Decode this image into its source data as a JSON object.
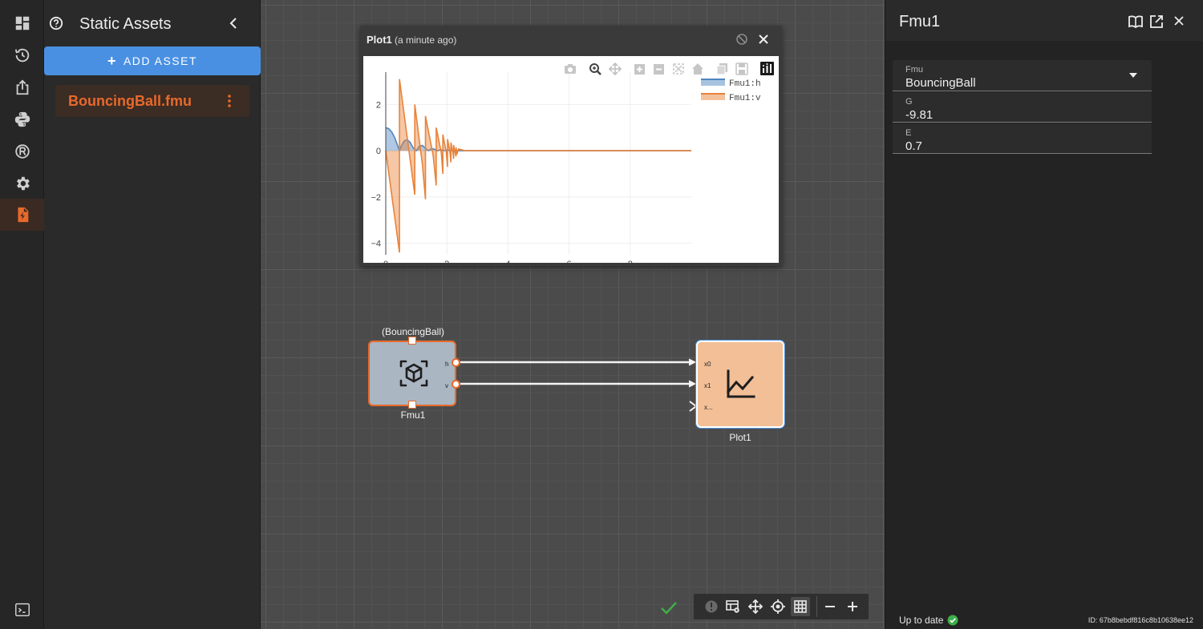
{
  "rail": {
    "items": [
      {
        "name": "dashboard",
        "icon": "dashboard-icon"
      },
      {
        "name": "history",
        "icon": "history-icon"
      },
      {
        "name": "export",
        "icon": "export-icon"
      },
      {
        "name": "python",
        "icon": "python-icon"
      },
      {
        "name": "registry",
        "icon": "registry-icon"
      },
      {
        "name": "settings",
        "icon": "gear-icon"
      },
      {
        "name": "static-assets",
        "icon": "file-bolt-icon",
        "active": true
      }
    ],
    "terminal_icon": "terminal-icon"
  },
  "assets_panel": {
    "title": "Static Assets",
    "add_button": "ADD ASSET",
    "items": [
      {
        "label": "BouncingBall.fmu"
      }
    ]
  },
  "plot_window": {
    "title": "Plot1",
    "subtitle": "(a minute ago)",
    "chart_data": {
      "type": "area",
      "title": "",
      "xlabel": "",
      "ylabel": "",
      "xlim": [
        0,
        10
      ],
      "ylim": [
        -4.5,
        3.4
      ],
      "x_ticks": [
        0,
        2,
        4,
        6,
        8
      ],
      "y_ticks": [
        -4,
        -2,
        0,
        2
      ],
      "grid": true,
      "legend_position": "top-right",
      "series": [
        {
          "name": "Fmu1:h",
          "color": "#4f86c0",
          "x": [
            0,
            0.1,
            0.2,
            0.3,
            0.45,
            0.5,
            0.6,
            0.7,
            0.8,
            0.9,
            1.0,
            1.1,
            1.2,
            1.3,
            1.4,
            1.5,
            1.6,
            1.7,
            1.8,
            1.9,
            2.0,
            2.1,
            2.2,
            2.3,
            2.4,
            2.6,
            10
          ],
          "y": [
            1.0,
            0.95,
            0.8,
            0.55,
            0.0,
            0.18,
            0.42,
            0.48,
            0.36,
            0.12,
            0.0,
            0.2,
            0.23,
            0.1,
            0.0,
            0.1,
            0.06,
            0.0,
            0.05,
            0.0,
            0.03,
            0.0,
            0.015,
            0.0,
            0.005,
            0.0,
            0.0
          ]
        },
        {
          "name": "Fmu1:v",
          "color": "#e8833a",
          "x": [
            0,
            0.45,
            0.45,
            0.95,
            0.95,
            1.2,
            1.3,
            1.3,
            1.55,
            1.65,
            1.65,
            1.82,
            1.87,
            1.87,
            1.98,
            2.02,
            2.02,
            2.1,
            2.13,
            2.13,
            2.19,
            2.22,
            2.22,
            2.26,
            2.3,
            2.3,
            2.33,
            2.38,
            2.6,
            10
          ],
          "y": [
            0.0,
            -4.4,
            3.1,
            -1.9,
            2.0,
            -0.6,
            -2.1,
            1.5,
            -0.2,
            -1.5,
            1.0,
            -0.1,
            -1.0,
            0.7,
            -0.05,
            -0.7,
            0.5,
            -0.05,
            -0.5,
            0.35,
            -0.02,
            -0.35,
            0.25,
            -0.02,
            -0.25,
            0.15,
            -0.15,
            0.08,
            0.0,
            0.0
          ]
        }
      ]
    }
  },
  "nodes": {
    "fmu": {
      "top_label": "(BouncingBall)",
      "bottom_label": "Fmu1",
      "ports": [
        "h",
        "v"
      ]
    },
    "plot": {
      "label": "Plot1",
      "inputs": [
        "x0",
        "x1",
        "x..."
      ]
    }
  },
  "inspector": {
    "title": "Fmu1",
    "fields": [
      {
        "label": "Fmu",
        "value": "BouncingBall"
      },
      {
        "label": "G",
        "value": "-9.81"
      },
      {
        "label": "E",
        "value": "0.7"
      }
    ],
    "status": "Up to date",
    "id": "ID: 67b8bebdf816c8b10638ee12"
  },
  "colors": {
    "accent": "#e8692b",
    "primary_button": "#4a90e2",
    "success": "#3fae49"
  }
}
